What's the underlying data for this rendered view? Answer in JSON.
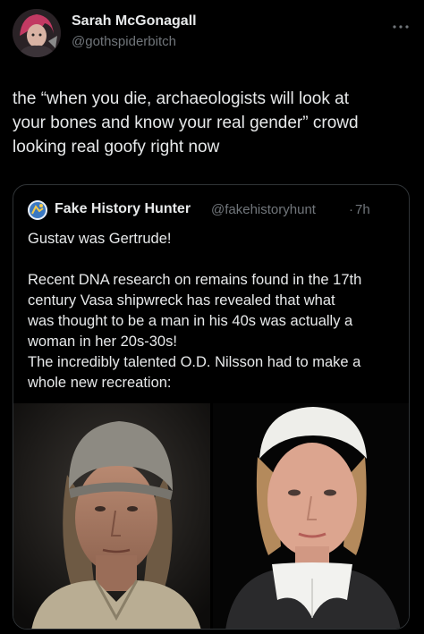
{
  "tweet": {
    "author_name": "Sarah McGonagall",
    "author_handle": "@gothspiderbitch",
    "text_lines": [
      "the “when you die, archaeologists will look at",
      "your bones and know your real gender” crowd",
      "looking real goofy right now"
    ]
  },
  "quote": {
    "author_name": "Fake History Hunter",
    "author_handle": "@fakehistoryhunt",
    "separator": "·",
    "time": "7h",
    "lines": [
      "Gustav was Gertrude!",
      "",
      "Recent DNA research on remains found in the 17th",
      "century Vasa shipwreck has revealed that what",
      "was thought to be a man in his 40s was actually a",
      "woman in her 20s-30s!",
      "The incredibly talented O.D. Nilsson had to make a",
      "whole new recreation:"
    ]
  },
  "icons": {
    "more": "more-horizontal-icon"
  },
  "colors": {
    "background": "#000000",
    "text_primary": "#e7e9ea",
    "text_secondary": "#71767b",
    "border": "#2f3336"
  }
}
